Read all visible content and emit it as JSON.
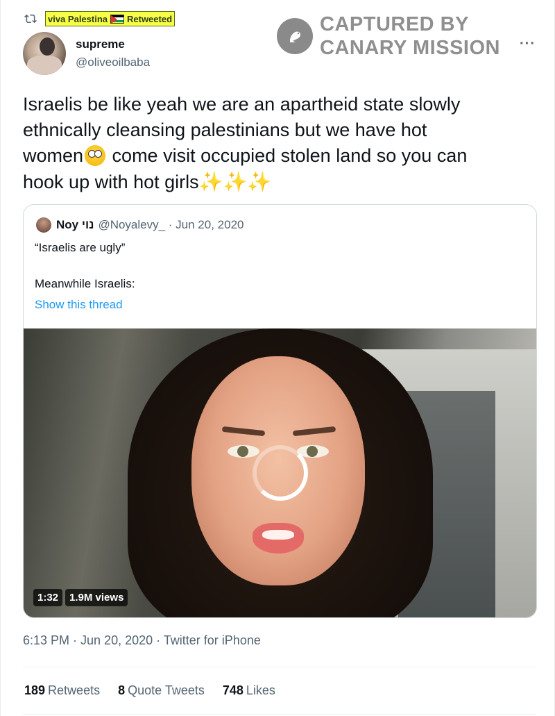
{
  "retweet": {
    "by": "viva Palestina",
    "label": "Retweeted"
  },
  "author": {
    "name": "supreme",
    "handle": "@oliveoilbaba"
  },
  "watermark": {
    "line1": "CAPTURED BY",
    "line2": "CANARY MISSION"
  },
  "more_label": "···",
  "tweet": {
    "line1": "Israelis be like yeah we are an apartheid state slowly",
    "line2": "ethnically cleansing palestinians but we have hot",
    "line3a": "women",
    "line3b": " come visit occupied stolen land so you can",
    "line4": "hook up with hot girls",
    "sparkles": "✨✨✨"
  },
  "quote": {
    "name": "Noy נוי",
    "meta": "@Noyalevy_ · Jun 20, 2020",
    "line1": "“Israelis are ugly”",
    "line2": "Meanwhile Israelis:",
    "link": "Show this thread",
    "video": {
      "duration": "1:32",
      "views": "1.9M views"
    }
  },
  "timestamp": "6:13 PM · Jun 20, 2020 · Twitter for iPhone",
  "stats": {
    "retweets_count": "189",
    "retweets_label": "Retweets",
    "quotes_count": "8",
    "quotes_label": "Quote Tweets",
    "likes_count": "748",
    "likes_label": "Likes"
  },
  "colors": {
    "link": "#1d9bf0",
    "highlight": "#f6ff45",
    "muted": "#536471"
  },
  "icons": [
    "retweet-icon",
    "palestine-flag-icon",
    "canary-logo-icon",
    "more-icon",
    "loading-spinner-icon"
  ]
}
